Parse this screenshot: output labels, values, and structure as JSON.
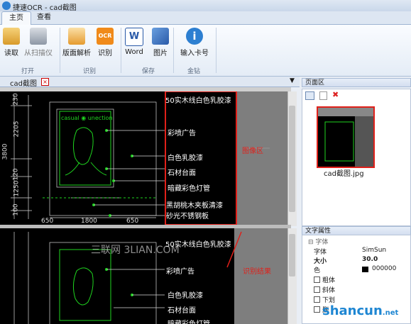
{
  "window": {
    "title": "捷速OCR - cad截图"
  },
  "tabs": [
    {
      "label": "主页"
    },
    {
      "label": "查看"
    }
  ],
  "ribbon": {
    "buttons": [
      {
        "label": "读取"
      },
      {
        "label": "从扫描仪"
      },
      {
        "label": "版面解析"
      },
      {
        "label": "识别"
      },
      {
        "label": "Word"
      },
      {
        "label": "图片"
      },
      {
        "label": "输入卡号"
      }
    ],
    "groups": [
      {
        "label": "打开"
      },
      {
        "label": "识别"
      },
      {
        "label": "保存"
      },
      {
        "label": "金钻"
      }
    ]
  },
  "document": {
    "tab_label": "cad截图",
    "annotations": {
      "top": "图像区",
      "bottom": "识别结果"
    },
    "watermark": "三联网 3LIAN.COM",
    "top_labels": [
      "50实木线白色乳胶漆",
      "彩喷广告",
      "白色乳胶漆",
      "石材台面",
      "暗藏彩色灯管",
      "黑胡桃木夹板清漆",
      "砂光不锈钢板"
    ],
    "bottom_labels": [
      "50实木线白色乳胶漆",
      "彩喷广告",
      "白色乳胶漆",
      "石材台面",
      "暗藏彩色灯管"
    ],
    "dims_left": [
      "230",
      "2205",
      "3800",
      "120",
      "1250",
      "100"
    ],
    "dims_bottom": [
      "650",
      "1800",
      "650"
    ],
    "frame_caption": "casual ◉ unection"
  },
  "pages_panel": {
    "title": "页面区",
    "thumb_caption": "cad截图.jpg"
  },
  "props_panel": {
    "title": "文字属性",
    "section": "字体",
    "rows": [
      {
        "key": "字体",
        "value": "SimSun"
      },
      {
        "key": "大小",
        "value": "30.0"
      },
      {
        "key": "色",
        "value": "000000"
      },
      {
        "key": "粗体",
        "value": ""
      },
      {
        "key": "斜体",
        "value": ""
      },
      {
        "key": "下划",
        "value": ""
      },
      {
        "key": "删",
        "value": ""
      }
    ]
  },
  "brand_watermark": {
    "text": "shancun",
    "suffix": ".net"
  },
  "colors": {
    "accent": "#2d7fd1",
    "highlight_red": "#e0201a",
    "cad_green": "#1fd41f"
  }
}
